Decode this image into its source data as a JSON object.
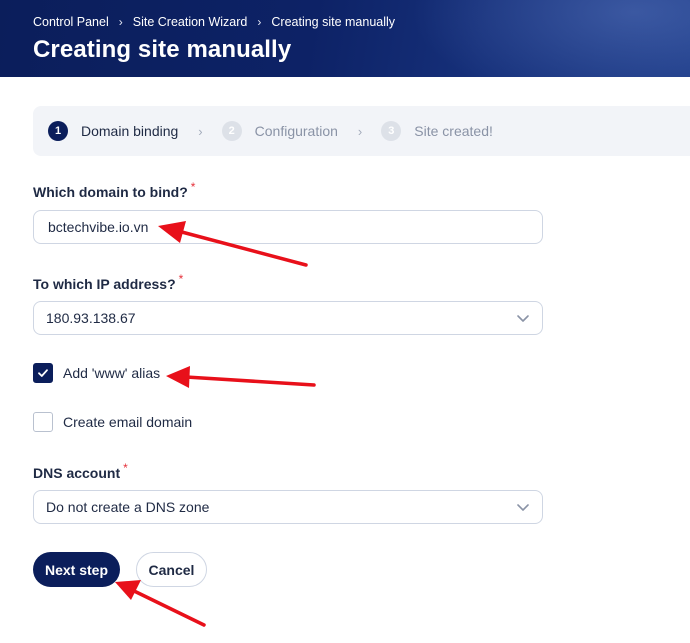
{
  "header": {
    "breadcrumb": [
      "Control Panel",
      "Site Creation Wizard",
      "Creating site manually"
    ],
    "title": "Creating site manually"
  },
  "stepper": {
    "steps": [
      {
        "number": "1",
        "label": "Domain binding",
        "state": "active"
      },
      {
        "number": "2",
        "label": "Configuration",
        "state": "inactive"
      },
      {
        "number": "3",
        "label": "Site created!",
        "state": "inactive"
      }
    ]
  },
  "form": {
    "domain": {
      "label": "Which domain to bind?",
      "required_mark": "*",
      "value": "bctechvibe.io.vn"
    },
    "ip": {
      "label": "To which IP address?",
      "required_mark": "*",
      "selected": "180.93.138.67"
    },
    "www_alias": {
      "label": "Add 'www' alias",
      "checked": true
    },
    "email_domain": {
      "label": "Create email domain",
      "checked": false
    },
    "dns": {
      "label": "DNS account",
      "required_mark": "*",
      "selected": "Do not create a DNS zone"
    }
  },
  "actions": {
    "next_label": "Next step",
    "cancel_label": "Cancel"
  },
  "colors": {
    "primary": "#0b1e5b",
    "required": "#e5303a",
    "annotation_arrow": "#e8101a"
  },
  "icons": {
    "breadcrumb_sep": "chevron-right-icon",
    "select_caret": "chevron-down-icon",
    "check": "check-icon"
  }
}
